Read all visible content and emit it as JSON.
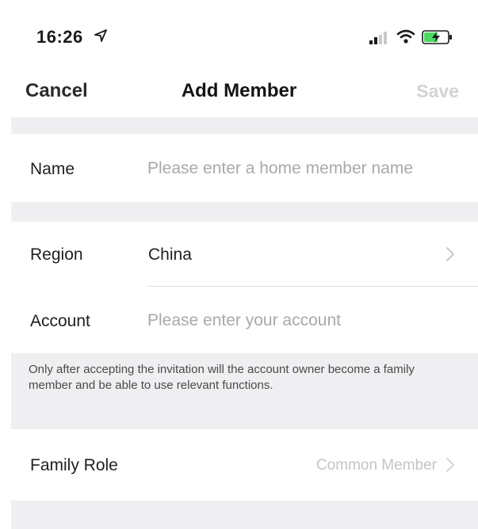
{
  "status_bar": {
    "time": "16:26"
  },
  "nav": {
    "cancel_label": "Cancel",
    "title": "Add Member",
    "save_label": "Save"
  },
  "form": {
    "name": {
      "label": "Name",
      "placeholder": "Please enter a home member name"
    },
    "region": {
      "label": "Region",
      "value": "China"
    },
    "account": {
      "label": "Account",
      "placeholder": "Please enter your account"
    },
    "notice": "Only after accepting the invitation will the account owner become a family member and be able to use relevant functions.",
    "family_role": {
      "label": "Family Role",
      "value": "Common Member"
    }
  },
  "colors": {
    "band": "#efeff1",
    "placeholder": "#a9a9ab",
    "disabled_save": "#d3d3d3",
    "battery_fill": "#4cd964"
  },
  "icons": [
    "location-arrow-icon",
    "cellular-signal-icon",
    "wifi-icon",
    "battery-charging-icon",
    "chevron-right-icon"
  ]
}
